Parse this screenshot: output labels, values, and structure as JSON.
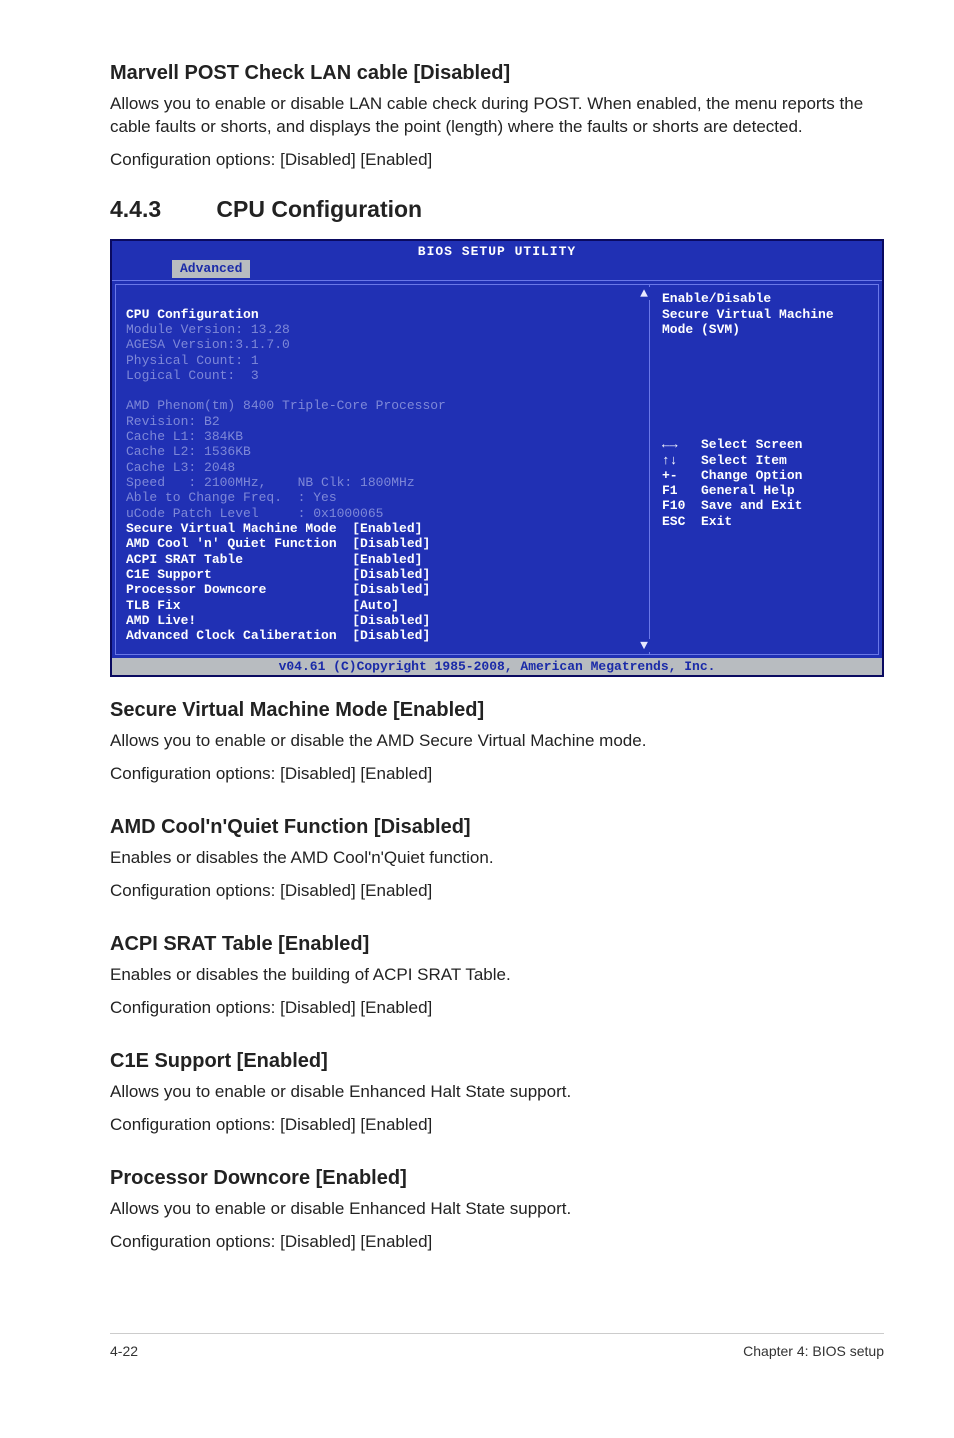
{
  "sec1": {
    "title": "Marvell POST Check LAN cable [Disabled]",
    "p1": "Allows you to enable or disable LAN cable check during POST. When enabled, the menu reports the cable faults or shorts, and displays the point (length) where the faults or shorts are detected.",
    "p2": "Configuration options: [Disabled] [Enabled]"
  },
  "sec_num": {
    "num": "4.4.3",
    "title": "CPU Configuration"
  },
  "bios": {
    "title": "BIOS SETUP UTILITY",
    "tab": "Advanced",
    "header": "CPU Configuration",
    "info_lines": [
      "Module Version: 13.28",
      "AGESA Version:3.1.7.0",
      "Physical Count: 1",
      "Logical Count:  3"
    ],
    "cpu_lines": [
      "AMD Phenom(tm) 8400 Triple-Core Processor",
      "Revision: B2",
      "Cache L1: 384KB",
      "Cache L2: 1536KB",
      "Cache L3: 2048",
      "Speed   : 2100MHz,    NB Clk: 1800MHz",
      "Able to Change Freq.  : Yes",
      "uCode Patch Level     : 0x1000065"
    ],
    "options": [
      {
        "label": "Secure Virtual Machine Mode",
        "val": "[Enabled]"
      },
      {
        "label": "AMD Cool 'n' Quiet Function",
        "val": "[Disabled]"
      },
      {
        "label": "ACPI SRAT Table",
        "val": "[Enabled]"
      },
      {
        "label": "C1E Support",
        "val": "[Disabled]"
      },
      {
        "label": "Processor Downcore",
        "val": "[Disabled]"
      },
      {
        "label": "TLB Fix",
        "val": "[Auto]"
      },
      {
        "label": "AMD Live!",
        "val": "[Disabled]"
      },
      {
        "label": "Advanced Clock Caliberation",
        "val": "[Disabled]"
      }
    ],
    "right_top": "Enable/Disable\nSecure Virtual Machine\nMode (SVM)",
    "right_keys": "←→   Select Screen\n↑↓   Select Item\n+-   Change Option\nF1   General Help\nF10  Save and Exit\nESC  Exit",
    "footer": "v04.61 (C)Copyright 1985-2008, American Megatrends, Inc."
  },
  "sec2": {
    "title": "Secure Virtual Machine Mode [Enabled]",
    "p1": "Allows you to enable or disable the AMD Secure Virtual Machine mode.",
    "p2": "Configuration options: [Disabled] [Enabled]"
  },
  "sec3": {
    "title": "AMD Cool'n'Quiet Function [Disabled]",
    "p1": "Enables or disables the AMD Cool'n'Quiet function.",
    "p2": "Configuration options: [Disabled] [Enabled]"
  },
  "sec4": {
    "title": "ACPI SRAT Table [Enabled]",
    "p1": "Enables or disables the building of ACPI SRAT Table.",
    "p2": "Configuration options: [Disabled] [Enabled]"
  },
  "sec5": {
    "title": "C1E Support [Enabled]",
    "p1": "Allows you to enable or disable Enhanced Halt State support.",
    "p2": "Configuration options: [Disabled] [Enabled]"
  },
  "sec6": {
    "title": "Processor Downcore [Enabled]",
    "p1": "Allows you to enable or disable Enhanced Halt State support.",
    "p2": "Configuration options: [Disabled] [Enabled]"
  },
  "footer": {
    "left": "4-22",
    "right": "Chapter 4: BIOS setup"
  }
}
